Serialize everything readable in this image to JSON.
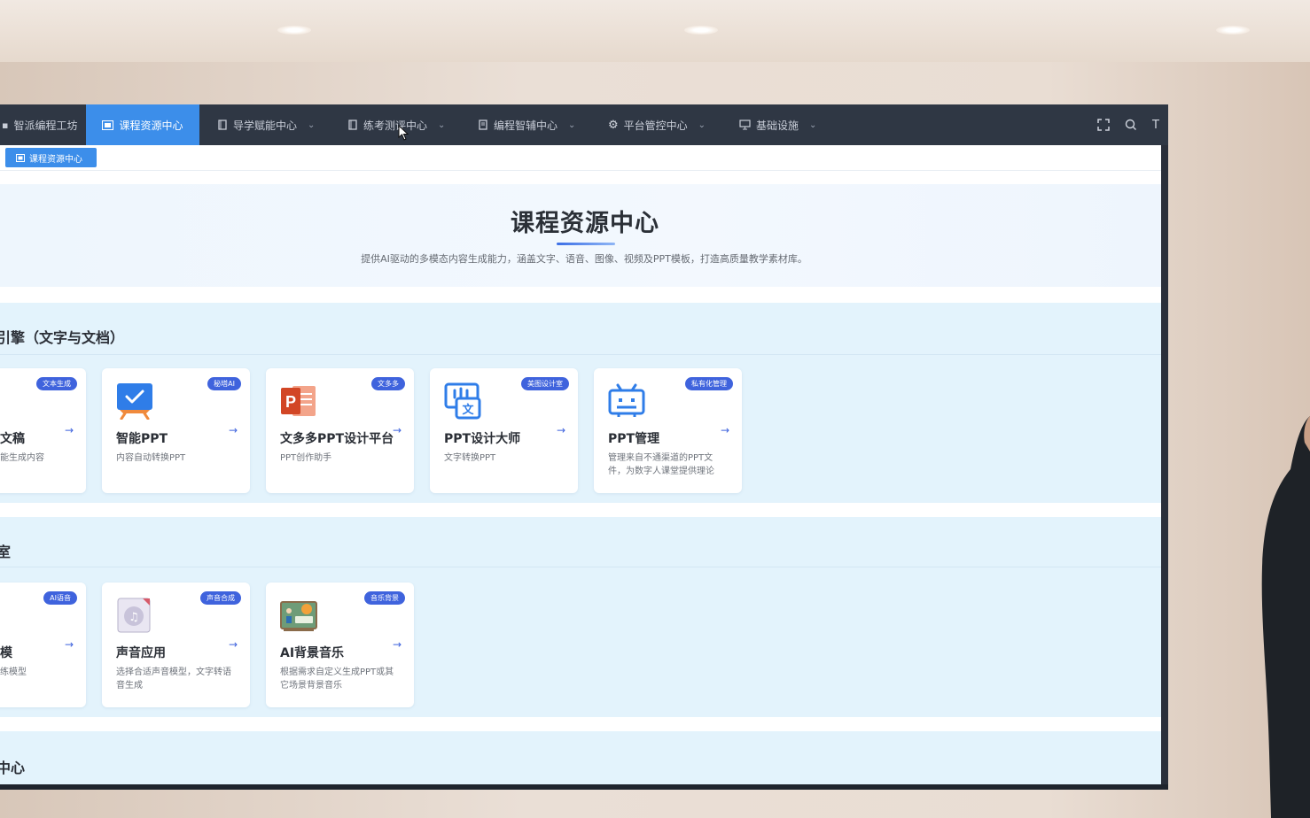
{
  "nav": {
    "items": [
      {
        "label": "智派编程工坊"
      },
      {
        "label": "课程资源中心"
      },
      {
        "label": "导学赋能中心"
      },
      {
        "label": "练考测评中心"
      },
      {
        "label": "编程智辅中心"
      },
      {
        "label": "平台管控中心"
      },
      {
        "label": "基础设施"
      }
    ],
    "right_text": "T"
  },
  "tabs": {
    "active_label": "课程资源中心"
  },
  "hero": {
    "title": "课程资源中心",
    "subtitle": "提供AI驱动的多模态内容生成能力，涵盖文字、语音、图像、视频及PPT模板，打造高质量教学素材库。"
  },
  "sections": [
    {
      "title": "引擎（文字与文档）",
      "cards": [
        {
          "badge": "文本生成",
          "title": "文稿",
          "desc": "能生成内容",
          "icon": "text-doc-icon"
        },
        {
          "badge": "秘塔AI",
          "title": "智能PPT",
          "desc": "内容自动转换PPT",
          "icon": "check-board-icon"
        },
        {
          "badge": "文多多",
          "title": "文多多PPT设计平台",
          "desc": "PPT创作助手",
          "icon": "powerpoint-icon"
        },
        {
          "badge": "美图设计室",
          "title": "PPT设计大师",
          "desc": "文字转换PPT",
          "icon": "text-convert-icon"
        },
        {
          "badge": "私有化管理",
          "title": "PPT管理",
          "desc": "管理来自不通渠道的PPT文件，为数字人课堂提供理论",
          "icon": "robot-icon"
        }
      ]
    },
    {
      "title": "室",
      "cards": [
        {
          "badge": "AI语音",
          "title": "模",
          "desc": "练模型",
          "icon": "voice-icon"
        },
        {
          "badge": "声音合成",
          "title": "声音应用",
          "desc": "选择合适声音模型，文字转语音生成",
          "icon": "music-disc-icon"
        },
        {
          "badge": "音乐背景",
          "title": "AI背景音乐",
          "desc": "根据需求自定义生成PPT或其它场景背景音乐",
          "icon": "class-board-icon"
        }
      ]
    },
    {
      "title": "中心",
      "cards": []
    }
  ],
  "colors": {
    "accent": "#3c8eea",
    "badge": "#3f63dd",
    "nav_bg": "#2f3744",
    "section_bg": "#e3f3fc"
  }
}
